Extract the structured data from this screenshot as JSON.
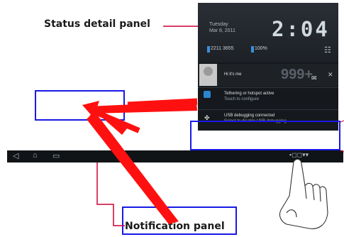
{
  "labels": {
    "status_detail_panel": "Status detail panel",
    "notification_panel": "Notification panel"
  },
  "panel": {
    "day": "Tuesday",
    "date": "Mar 8, 2011",
    "clock": "2:04",
    "signal_text": "2211 3655",
    "battery": "100%",
    "message": {
      "sender": "Hi it's me",
      "count": "999+"
    },
    "tethering": {
      "title": "Tethering or hotspot active",
      "subtitle": "Touch to configure"
    },
    "usb": {
      "title": "USB debugging connected",
      "subtitle": "Select to disable USB debugging"
    }
  },
  "icons": {
    "settings": "settings-icon",
    "mail": "mail-icon",
    "close": "close-icon",
    "back": "back-icon",
    "home": "home-icon",
    "recent": "recent-apps-icon",
    "hand": "pointing-hand-icon"
  },
  "colors": {
    "arrow": "#ff0000",
    "callout": "#1919e6",
    "leader": "#cc0033"
  }
}
